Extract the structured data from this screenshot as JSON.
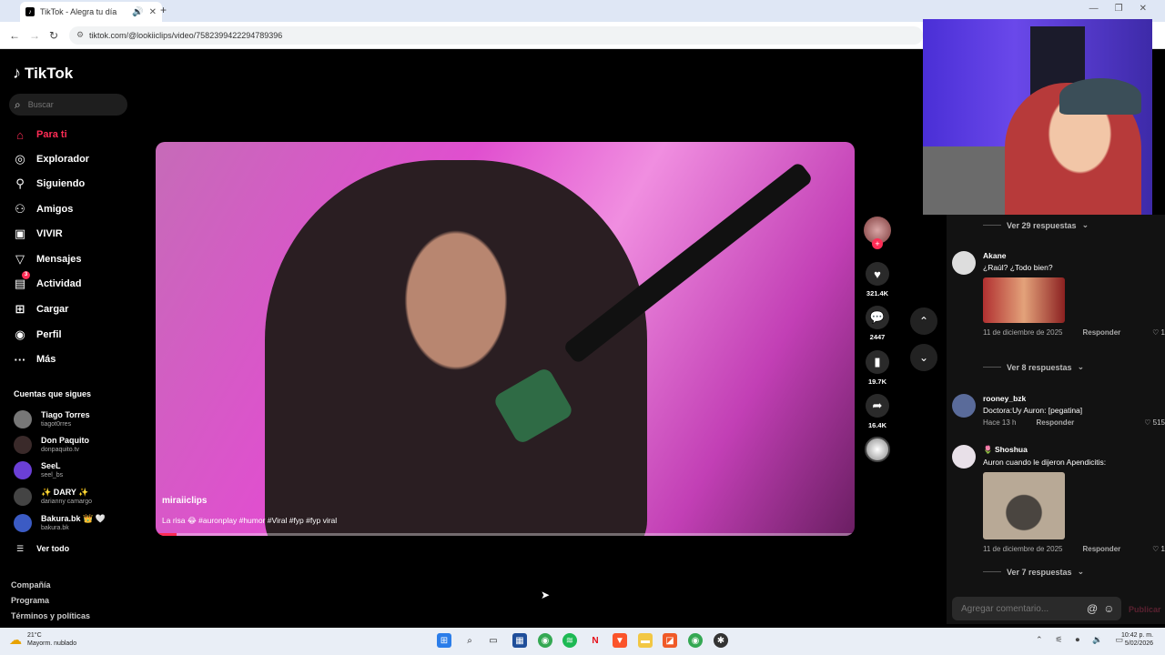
{
  "browser": {
    "tab_title": "TikTok - Alegra tu día",
    "url": "tiktok.com/@lookiiclips/video/7582399422294789396"
  },
  "sidebar": {
    "brand": "TikTok",
    "search_placeholder": "Buscar",
    "nav": [
      {
        "label": "Para ti",
        "icon": "home-icon",
        "active": true
      },
      {
        "label": "Explorador",
        "icon": "compass-icon"
      },
      {
        "label": "Siguiendo",
        "icon": "following-icon"
      },
      {
        "label": "Amigos",
        "icon": "friends-icon"
      },
      {
        "label": "VIVIR",
        "icon": "live-icon"
      },
      {
        "label": "Mensajes",
        "icon": "messages-icon"
      },
      {
        "label": "Actividad",
        "icon": "activity-icon",
        "badge": "3"
      },
      {
        "label": "Cargar",
        "icon": "upload-icon"
      },
      {
        "label": "Perfil",
        "icon": "profile-icon"
      },
      {
        "label": "Más",
        "icon": "more-icon"
      }
    ],
    "following_heading": "Cuentas que sigues",
    "accounts": [
      {
        "name": "Tiago Torres",
        "handle": "tiagot0rres"
      },
      {
        "name": "Don Paquito",
        "handle": "donpaquito.tv"
      },
      {
        "name": "SeeL",
        "handle": "seel_bs"
      },
      {
        "name": "✨ DARY ✨",
        "handle": "darianny camargo"
      },
      {
        "name": "Bakura.bk 👑 🤍",
        "handle": "bakura.bk"
      }
    ],
    "see_all": "Ver todo",
    "footer": [
      "Compañía",
      "Programa",
      "Términos y políticas"
    ]
  },
  "video": {
    "author": "miraiiclips",
    "caption": "La risa 😂 #auronplay #humor #Viral #fyp #fyp viral",
    "progress": 0.03
  },
  "actions": {
    "likes": "321.4K",
    "comments": "2447",
    "saves": "19.7K",
    "shares": "16.4K"
  },
  "comments": {
    "top_more": "Ver 29 respuestas",
    "items": [
      {
        "user": "Akane",
        "text": "¿Raúl? ¿Todo bien?",
        "has_image": true,
        "date": "11 de diciembre de 2025",
        "reply": "Responder",
        "likes": "1",
        "more": "Ver 8 respuestas"
      },
      {
        "user": "rooney_bzk",
        "text": "Doctora:Uy Auron: [pegatina]",
        "has_image": false,
        "date": "Hace 13 h",
        "reply": "Responder",
        "likes": "515"
      },
      {
        "user": "🌷 Shoshua",
        "text": "Auron cuando le dijeron Apendicitis:",
        "has_image": true,
        "date": "11 de diciembre de 2025",
        "reply": "Responder",
        "likes": "1",
        "more": "Ver 7 respuestas"
      }
    ],
    "add_placeholder": "Agregar comentario...",
    "publish": "Publicar"
  },
  "taskbar": {
    "temp": "21°C",
    "weather": "Mayorm. nublado",
    "time": "10:42 p. m.",
    "date": "5/02/2026"
  }
}
